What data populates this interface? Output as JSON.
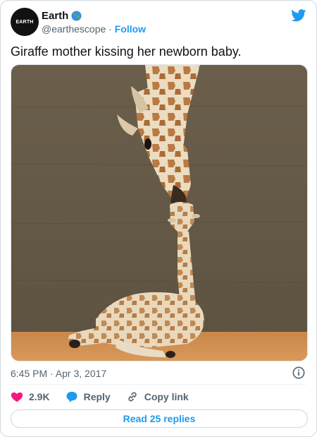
{
  "author": {
    "display_name": "Earth",
    "handle": "@earthescope",
    "follow_label": "Follow",
    "separator": "·",
    "avatar_text": "EARTH",
    "verified_emoji_icon": "globe-icon"
  },
  "tweet": {
    "text": "Giraffe mother kissing her newborn baby.",
    "time": "6:45 PM · Apr 3, 2017",
    "image_icon": "giraffe-photo"
  },
  "actions": {
    "likes_count": "2.9K",
    "reply_label": "Reply",
    "copy_link_label": "Copy link"
  },
  "read_replies_label": "Read 25 replies",
  "colors": {
    "accent": "#1d9bf0",
    "like": "#f91880",
    "muted_text": "#536471",
    "border": "#cfd9de"
  }
}
